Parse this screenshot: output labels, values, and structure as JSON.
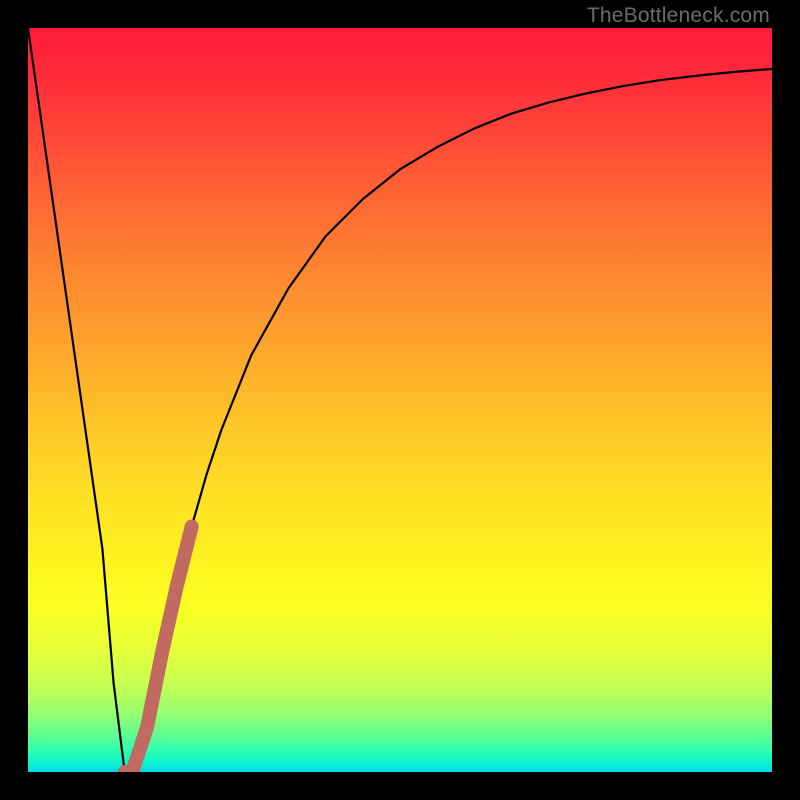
{
  "watermark": "TheBottleneck.com",
  "colors": {
    "curve": "#000000",
    "highlight": "#c16a62",
    "background_border": "#000000"
  },
  "chart_data": {
    "type": "line",
    "title": "",
    "xlabel": "",
    "ylabel": "",
    "xlim": [
      0,
      100
    ],
    "ylim": [
      0,
      100
    ],
    "grid": false,
    "legend": false,
    "series": [
      {
        "name": "bottleneck-curve",
        "color": "#000000",
        "x": [
          0,
          2,
          4,
          6,
          8,
          10,
          11.5,
          13,
          14,
          15,
          16,
          18,
          20,
          22,
          24,
          26,
          30,
          35,
          40,
          45,
          50,
          55,
          60,
          65,
          70,
          75,
          80,
          85,
          90,
          95,
          100
        ],
        "y": [
          100,
          86,
          72,
          58,
          44,
          30,
          12,
          0,
          0,
          1,
          6,
          16,
          25,
          33,
          40,
          46,
          56,
          65,
          72,
          77,
          81,
          84,
          86.5,
          88.5,
          90,
          91.2,
          92.2,
          93,
          93.6,
          94.1,
          94.5
        ]
      },
      {
        "name": "highlight-segment",
        "color": "#c16a62",
        "x": [
          13,
          14,
          16,
          18,
          20,
          22
        ],
        "y": [
          0,
          0,
          6,
          16,
          25,
          33
        ]
      }
    ],
    "annotations": []
  }
}
